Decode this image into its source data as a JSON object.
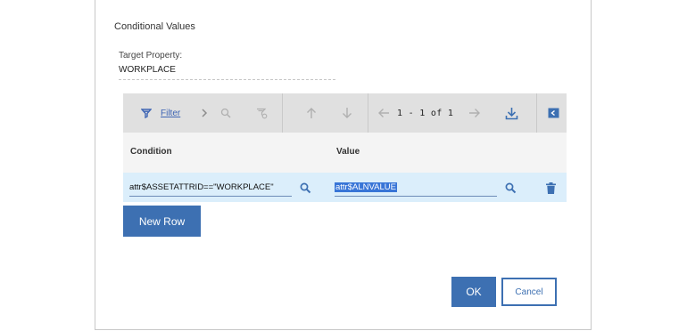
{
  "dialog": {
    "title": "Conditional Values",
    "target_property_label": "Target Property:",
    "target_property_value": "WORKPLACE"
  },
  "toolbar": {
    "filter_label": "Filter",
    "pager_text": "1 - 1 of 1"
  },
  "table": {
    "columns": [
      "Condition",
      "Value"
    ],
    "rows": [
      {
        "condition": "attr$ASSETATTRID==\"WORKPLACE\"",
        "value": "attr$ALNVALUE"
      }
    ]
  },
  "buttons": {
    "new_row": "New Row",
    "ok": "OK",
    "cancel": "Cancel"
  },
  "colors": {
    "accent": "#3d70b2",
    "row_highlight": "#dbeefb",
    "toolbar_bg": "#e0e0e0"
  }
}
